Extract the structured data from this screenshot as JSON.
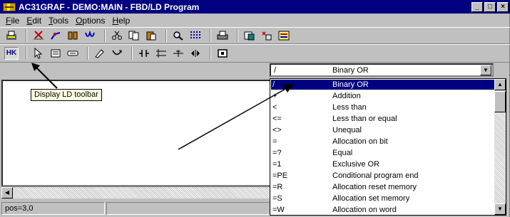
{
  "window": {
    "title": "AC31GRAF - DEMO:MAIN - FBD/LD Program",
    "controls": [
      "_",
      "□",
      "×"
    ]
  },
  "menu": [
    {
      "label": "File",
      "access": "F",
      "rest": "ile"
    },
    {
      "label": "Edit",
      "access": "E",
      "rest": "dit"
    },
    {
      "label": "Tools",
      "access": "T",
      "rest": "ools"
    },
    {
      "label": "Options",
      "access": "O",
      "rest": "ptions"
    },
    {
      "label": "Help",
      "access": "H",
      "rest": "elp"
    }
  ],
  "toolbar1_icons": [
    "print-preview-icon",
    "cut-icon",
    "wire-icon",
    "block-icon",
    "coil-icon",
    "scissors-icon",
    "copy-icon",
    "paste-icon",
    "zoom-icon",
    "grid-icon",
    "printer-icon",
    "properties-icon",
    "variables-icon",
    "compile-icon"
  ],
  "toolbar2": {
    "ld_button_glyph": "HK",
    "tooltip": "Display LD toolbar"
  },
  "combo": {
    "symbol": "/",
    "description": "Binary OR"
  },
  "operators": [
    {
      "symbol": "/",
      "description": "Binary OR",
      "selected": true
    },
    {
      "symbol": "+",
      "description": "Addition"
    },
    {
      "symbol": "<",
      "description": "Less than"
    },
    {
      "symbol": "<=",
      "description": "Less than or equal"
    },
    {
      "symbol": "<>",
      "description": "Unequal"
    },
    {
      "symbol": "=",
      "description": "Allocation on bit"
    },
    {
      "symbol": "=?",
      "description": "Equal"
    },
    {
      "symbol": "=1",
      "description": "Exclusive OR"
    },
    {
      "symbol": "=PE",
      "description": "Conditional program end"
    },
    {
      "symbol": "=R",
      "description": "Allocation reset memory"
    },
    {
      "symbol": "=S",
      "description": "Allocation set memory"
    },
    {
      "symbol": "=W",
      "description": "Allocation on word"
    }
  ],
  "status": {
    "position": "pos=3,0"
  }
}
